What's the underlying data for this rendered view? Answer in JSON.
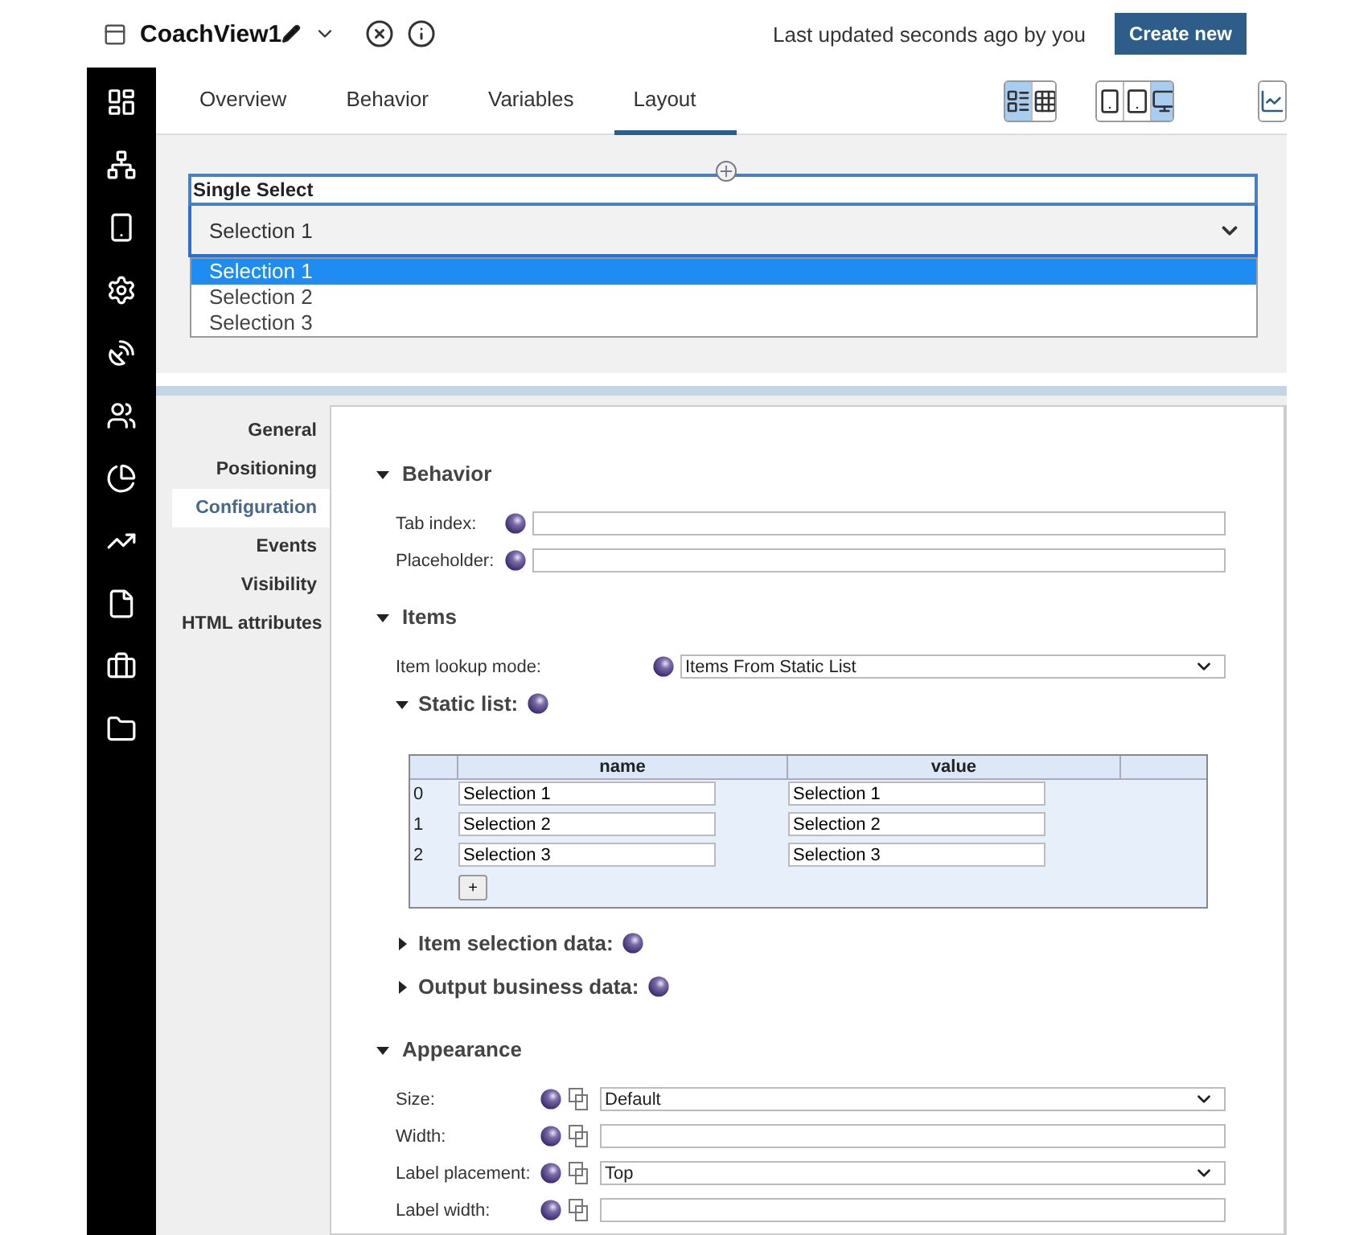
{
  "header": {
    "title": "CoachView1",
    "status": "Last updated seconds ago by you",
    "create_button": "Create new"
  },
  "tabs": [
    {
      "label": "Overview",
      "selected": false
    },
    {
      "label": "Behavior",
      "selected": false
    },
    {
      "label": "Variables",
      "selected": false
    },
    {
      "label": "Layout",
      "selected": true
    }
  ],
  "view_toggles": [
    {
      "kind": "form",
      "selected": true
    },
    {
      "kind": "grid",
      "selected": false
    }
  ],
  "device_toggles": [
    {
      "kind": "phone",
      "selected": false
    },
    {
      "kind": "tablet",
      "selected": false
    },
    {
      "kind": "desktop",
      "selected": true
    }
  ],
  "canvas": {
    "label": "Single Select",
    "value": "Selection 1",
    "expanded": true,
    "options": [
      {
        "label": "Selection 1",
        "selected": true
      },
      {
        "label": "Selection 2",
        "selected": false
      },
      {
        "label": "Selection 3",
        "selected": false
      }
    ]
  },
  "property_nav": [
    {
      "label": "General",
      "selected": false
    },
    {
      "label": "Positioning",
      "selected": false
    },
    {
      "label": "Configuration",
      "selected": true
    },
    {
      "label": "Events",
      "selected": false
    },
    {
      "label": "Visibility",
      "selected": false
    },
    {
      "label": "HTML attributes",
      "selected": false
    }
  ],
  "sections": [
    {
      "title": "Behavior",
      "expanded": true,
      "content": [
        {
          "kind": "text",
          "label": "Tab index:",
          "responsive": false
        },
        {
          "kind": "text",
          "label": "Placeholder:",
          "responsive": false
        }
      ]
    },
    {
      "title": "Items",
      "expanded": true,
      "content": [
        {
          "kind": "select",
          "label": "Item lookup mode:",
          "value": "Items From Static List",
          "responsive": false,
          "wide": true
        },
        {
          "kind": "subsection",
          "title": "Static list:",
          "expanded": true,
          "table": {
            "columns": [
              "name",
              "value"
            ],
            "rows": [
              {
                "index": "0",
                "name": "Selection 1",
                "value": "Selection 1"
              },
              {
                "index": "1",
                "name": "Selection 2",
                "value": "Selection 2"
              },
              {
                "index": "2",
                "name": "Selection 3",
                "value": "Selection 3"
              }
            ],
            "add_button": "+"
          }
        },
        {
          "kind": "subsection",
          "title": "Item selection data:",
          "expanded": false
        },
        {
          "kind": "subsection",
          "title": "Output business data:",
          "expanded": false
        }
      ]
    },
    {
      "title": "Appearance",
      "expanded": true,
      "content": [
        {
          "kind": "select",
          "label": "Size:",
          "value": "Default",
          "responsive": true
        },
        {
          "kind": "text",
          "label": "Width:",
          "responsive": true
        },
        {
          "kind": "select",
          "label": "Label placement:",
          "value": "Top",
          "responsive": true
        },
        {
          "kind": "text",
          "label": "Label width:",
          "responsive": true
        }
      ]
    }
  ]
}
